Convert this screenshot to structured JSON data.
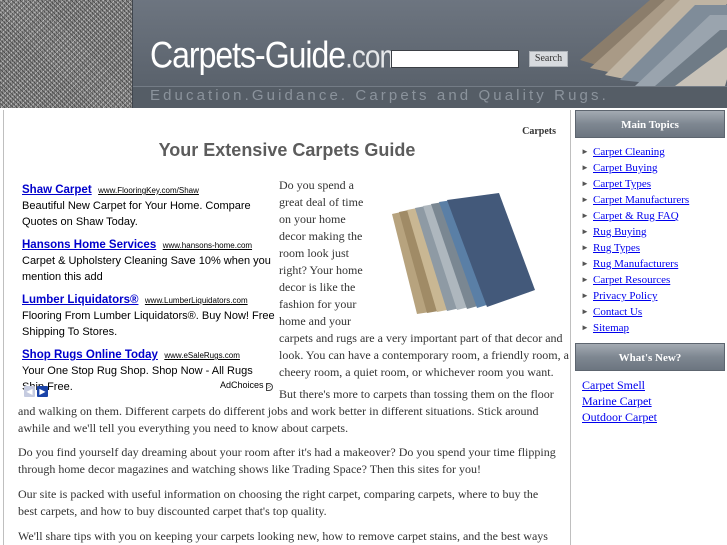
{
  "header": {
    "logo_main": "Carpets-Guide",
    "logo_tld": ".com",
    "tagline": "Education.Guidance. Carpets and Quality Rugs.",
    "search_placeholder": "",
    "search_button": "Search"
  },
  "main": {
    "breadcrumb": "Carpets",
    "title": "Your Extensive Carpets Guide",
    "ads": [
      {
        "title": "Shaw Carpet",
        "url": "www.FlooringKey.com/Shaw",
        "desc": "Beautiful New Carpet for Your Home. Compare Quotes on Shaw Today."
      },
      {
        "title": "Hansons Home Services",
        "url": "www.hansons-home.com",
        "desc": "Carpet & Upholstery Cleaning Save 10% when you mention this add"
      },
      {
        "title": "Lumber Liquidators®",
        "url": "www.LumberLiquidators.com",
        "desc": "Flooring From Lumber Liquidators®. Buy Now! Free Shipping To Stores."
      },
      {
        "title": "Shop Rugs Online Today",
        "url": "www.eSaleRugs.com",
        "desc": "Your One Stop Rug Shop. Shop Now - All Rugs Ship Free."
      }
    ],
    "adchoices": "AdChoices",
    "intro_top": "Do you spend a great deal of time on your home decor making the room look just right? Your home decor is like the fashion for your home and your",
    "intro_rest": "carpets and rugs are a very important part of that decor and look. You can have a contemporary room, a friendly room, a cheery room, a quiet room, or whichever room you want.",
    "para2_first": "But there's more to carpets than tossing them on the floor",
    "para2_rest": "and walking on them. Different carpets do different jobs and work better in different situations. Stick around awhile and we'll tell you everything you need to know about carpets.",
    "para3": "Do you find yourself day dreaming about your room after it's had a makeover? Do you spend your time flipping through home decor magazines and watching shows like Trading Space? Then this sites for you!",
    "para4": "Our site is packed with useful information on choosing the right carpet, comparing carpets, where to buy the best carpets, and how to buy discounted carpet that's top quality.",
    "para5": "We'll share tips with you on keeping your carpets looking new, how to remove carpet stains, and the best ways"
  },
  "sidebar": {
    "main_topics_title": "Main Topics",
    "topics": [
      "Carpet Cleaning",
      "Carpet Buying",
      "Carpet Types ",
      "Carpet Manufacturers",
      "Carpet & Rug FAQ",
      "Rug Buying",
      "Rug Types ",
      "Rug Manufacturers",
      "Carpet Resources",
      "Privacy Policy",
      "Contact Us",
      "Sitemap"
    ],
    "whats_new_title": "What's New?",
    "new_items": [
      "Carpet Smell",
      "Marine Carpet",
      "Outdoor Carpet"
    ]
  }
}
